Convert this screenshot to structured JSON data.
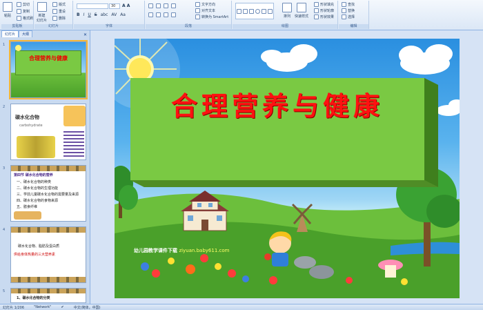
{
  "ribbon": {
    "paste": "粘贴",
    "cut": "剪切",
    "copy": "复制",
    "format_painter": "格式刷",
    "new_slide": "新建\n幻灯片",
    "layout": "版式",
    "reset": "重设",
    "delete": "删除",
    "font_size": "30",
    "text_direction": "文字方向",
    "align_text": "对齐文本",
    "convert_smartart": "转换为 SmartArt",
    "arrange": "排列",
    "quick_styles": "快速样式",
    "shape_fill": "形状填充",
    "shape_outline": "形状轮廓",
    "shape_effects": "形状效果",
    "find": "查找",
    "replace": "替换",
    "select": "选择",
    "groups": [
      "剪贴板",
      "幻灯片",
      "字体",
      "段落",
      "绘图",
      "编辑"
    ]
  },
  "left_panel": {
    "tabs": [
      "幻灯片",
      "大纲"
    ],
    "slides": [
      {
        "num": "1",
        "title": "合理营养与健康"
      },
      {
        "num": "2",
        "title": "碳水化合物",
        "subtitle": "carbohydrate"
      },
      {
        "num": "3",
        "title": "第四节 碳水化合物的营养",
        "items": [
          "一、碳水化合物的种类",
          "二、碳水化合物的生理功能",
          "三、学前儿童碳水化合物的需要量及来源",
          "四、碳水化合物的食物来源",
          "五、膳食纤维"
        ]
      },
      {
        "num": "4",
        "title": "碳水化合物、脂肪及蛋白质",
        "line2": "供给身体热量的三大营养素"
      },
      {
        "num": "5",
        "title": "1、碳水化合物的分类"
      }
    ]
  },
  "slide": {
    "title": "合理营养与健康",
    "watermark_prefix": "幼儿园教学课件下载 ",
    "watermark_url": "ziyuan.baby611.com"
  },
  "status": {
    "slide_info": "幻灯片 1/206",
    "theme": "\"Network\"",
    "language": "中文(简体，中国)"
  },
  "colors": {
    "ribbon_bg": "#dbe7f6",
    "slide_title": "#ff1111",
    "box_green": "#7ac943"
  }
}
